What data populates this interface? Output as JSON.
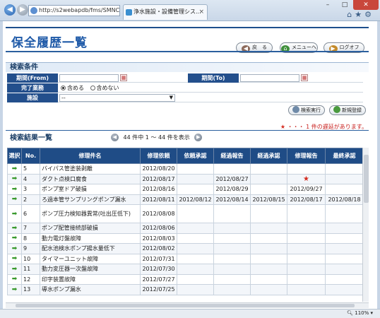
{
  "browser": {
    "url": "http://s2webapdb/fms/SMNC",
    "tab_title": "浄水施設・設備管理シス...",
    "minimize": "–",
    "maximize": "□",
    "close": "✕",
    "zoom": "110%"
  },
  "header": {
    "title": "保全履歴一覧",
    "buttons": {
      "back": "戻　る",
      "menu": "メニューへ",
      "logoff": "ログオフ"
    }
  },
  "search": {
    "heading": "検索条件",
    "period_from_label": "期間(From)",
    "period_to_label": "期間(To)",
    "done_label": "完了業務",
    "done_options": [
      "含める",
      "含めない"
    ],
    "done_selected": 0,
    "facility_label": "施設",
    "facility_value": "--",
    "search_button": "検索実行",
    "new_button": "新規登録"
  },
  "delay_notice": {
    "star": "★",
    "text": "・・・ 1 件の遅延があります。"
  },
  "results": {
    "heading": "検索結果一覧",
    "pager_text": "44 件中 1 ～ 44 件を表示",
    "columns": [
      "選択",
      "No.",
      "修理件名",
      "修理依頼",
      "依頼承認",
      "経過報告",
      "経過承認",
      "修理報告",
      "最終承認"
    ],
    "rows": [
      {
        "no": "5",
        "name": "バイパス管塗装剥離",
        "req": "2012/08/20",
        "req_ok": "",
        "prog": "",
        "prog_ok": "",
        "rep": "",
        "final": ""
      },
      {
        "no": "4",
        "name": "ダクト点検口腐食",
        "req": "2012/08/17",
        "req_ok": "",
        "prog": "2012/08/27",
        "prog_ok": "",
        "rep": "★",
        "final": ""
      },
      {
        "no": "3",
        "name": "ポンプ室ドア破損",
        "req": "2012/08/16",
        "req_ok": "",
        "prog": "2012/08/29",
        "prog_ok": "",
        "rep": "2012/09/27",
        "final": ""
      },
      {
        "no": "2",
        "name": "ろ過本管サンプリングポンプ漏水",
        "req": "2012/08/11",
        "req_ok": "2012/08/12",
        "prog": "2012/08/14",
        "prog_ok": "2012/08/15",
        "rep": "2012/08/17",
        "final": "2012/08/18"
      },
      {
        "no": "6",
        "name": "ポンプ圧力検知器異常(吐出圧低下)",
        "req": "2012/08/08",
        "req_ok": "",
        "prog": "",
        "prog_ok": "",
        "rep": "",
        "final": ""
      },
      {
        "no": "7",
        "name": "ポンプ配管接続部破損",
        "req": "2012/08/06",
        "req_ok": "",
        "prog": "",
        "prog_ok": "",
        "rep": "",
        "final": ""
      },
      {
        "no": "8",
        "name": "動力電灯盤故障",
        "req": "2012/08/03",
        "req_ok": "",
        "prog": "",
        "prog_ok": "",
        "rep": "",
        "final": ""
      },
      {
        "no": "9",
        "name": "配水池検水ポンプ揚水量低下",
        "req": "2012/08/02",
        "req_ok": "",
        "prog": "",
        "prog_ok": "",
        "rep": "",
        "final": ""
      },
      {
        "no": "10",
        "name": "タイマーユニット故障",
        "req": "2012/07/31",
        "req_ok": "",
        "prog": "",
        "prog_ok": "",
        "rep": "",
        "final": ""
      },
      {
        "no": "11",
        "name": "動力変圧器一次盤故障",
        "req": "2012/07/30",
        "req_ok": "",
        "prog": "",
        "prog_ok": "",
        "rep": "",
        "final": ""
      },
      {
        "no": "12",
        "name": "印字装置故障",
        "req": "2012/07/27",
        "req_ok": "",
        "prog": "",
        "prog_ok": "",
        "rep": "",
        "final": ""
      },
      {
        "no": "13",
        "name": "導水ポンプ漏水",
        "req": "2012/07/25",
        "req_ok": "",
        "prog": "",
        "prog_ok": "",
        "rep": "",
        "final": ""
      }
    ]
  },
  "colors": {
    "header_blue": "#1f4c86",
    "title_blue": "#1f5aa8",
    "delay_red": "#c8201e",
    "arrow_green": "#3a9a2e"
  }
}
